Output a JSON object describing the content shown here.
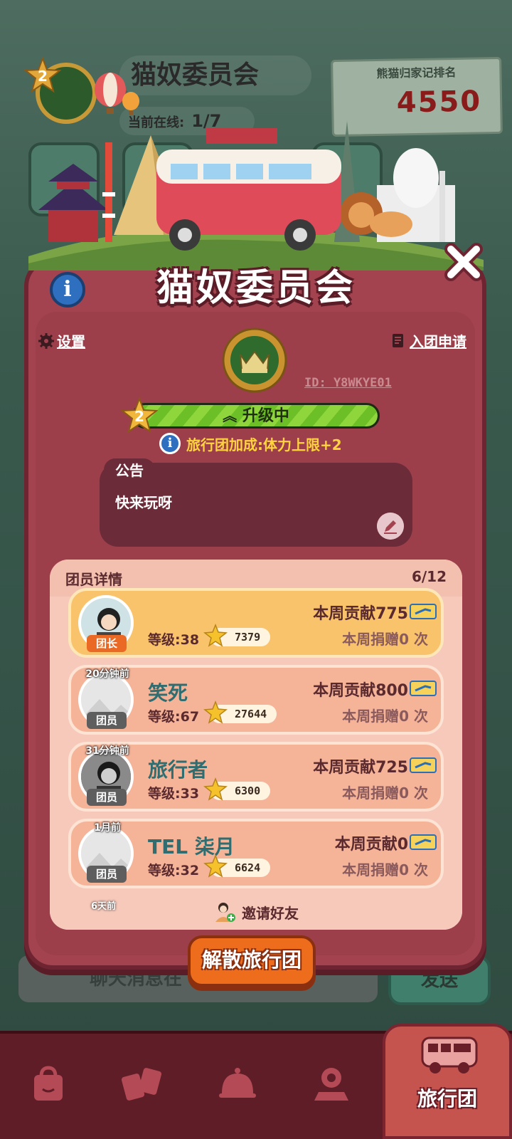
{
  "background": {
    "team_name": "猫奴委员会",
    "level": "2",
    "online_label": "当前在线:",
    "online_value": "1/7",
    "rank_label": "熊猫归家记排名",
    "rank_value": "4550",
    "chat_placeholder": "聊天消息在",
    "send_label": "发送"
  },
  "modal": {
    "title": "猫奴委员会",
    "settings_label": "设置",
    "apply_label": "入团申请",
    "team_id": "ID: Y8WKYE01",
    "level": "2",
    "level_status": "升级中",
    "level_progress": 1.0,
    "bonus_text": "旅行团加成:体力上限+2",
    "notice_title": "公告",
    "notice_text": "快来玩呀",
    "members_title": "团员详情",
    "members_count": "6/12",
    "members": [
      {
        "last_seen": "",
        "role": "团长",
        "name": "",
        "level": "等级:38",
        "stars": "7379",
        "contribution": "本周贡献775",
        "donation": "本周捐赠0 次",
        "leader": true
      },
      {
        "last_seen": "20分钟前",
        "role": "团员",
        "name": "笑死",
        "level": "等级:67",
        "stars": "27644",
        "contribution": "本周贡献800",
        "donation": "本周捐赠0 次",
        "leader": false
      },
      {
        "last_seen": "31分钟前",
        "role": "团员",
        "name": "旅行者",
        "level": "等级:33",
        "stars": "6300",
        "contribution": "本周贡献725",
        "donation": "本周捐赠0 次",
        "leader": false
      },
      {
        "last_seen": "1月前",
        "role": "团员",
        "name": "TEL 柒月",
        "level": "等级:32",
        "stars": "6624",
        "contribution": "本周贡献0",
        "donation": "本周捐赠0 次",
        "leader": false
      }
    ],
    "partial_row_last_seen": "6天前",
    "invite_label": "邀请好友",
    "disband_label": "解散旅行团"
  },
  "nav": {
    "active_label": "旅行团",
    "items": [
      "shop-bag-icon",
      "cards-icon",
      "service-bell-icon",
      "map-icon",
      "bus-icon"
    ]
  },
  "colors": {
    "modal_bg": "#a2434f",
    "modal_border": "#6e2431",
    "accent_orange": "#ee6d1c",
    "bonus_yellow": "#ffd23f",
    "name_teal": "#2f6d70",
    "nav_bg": "#5f1d27"
  }
}
